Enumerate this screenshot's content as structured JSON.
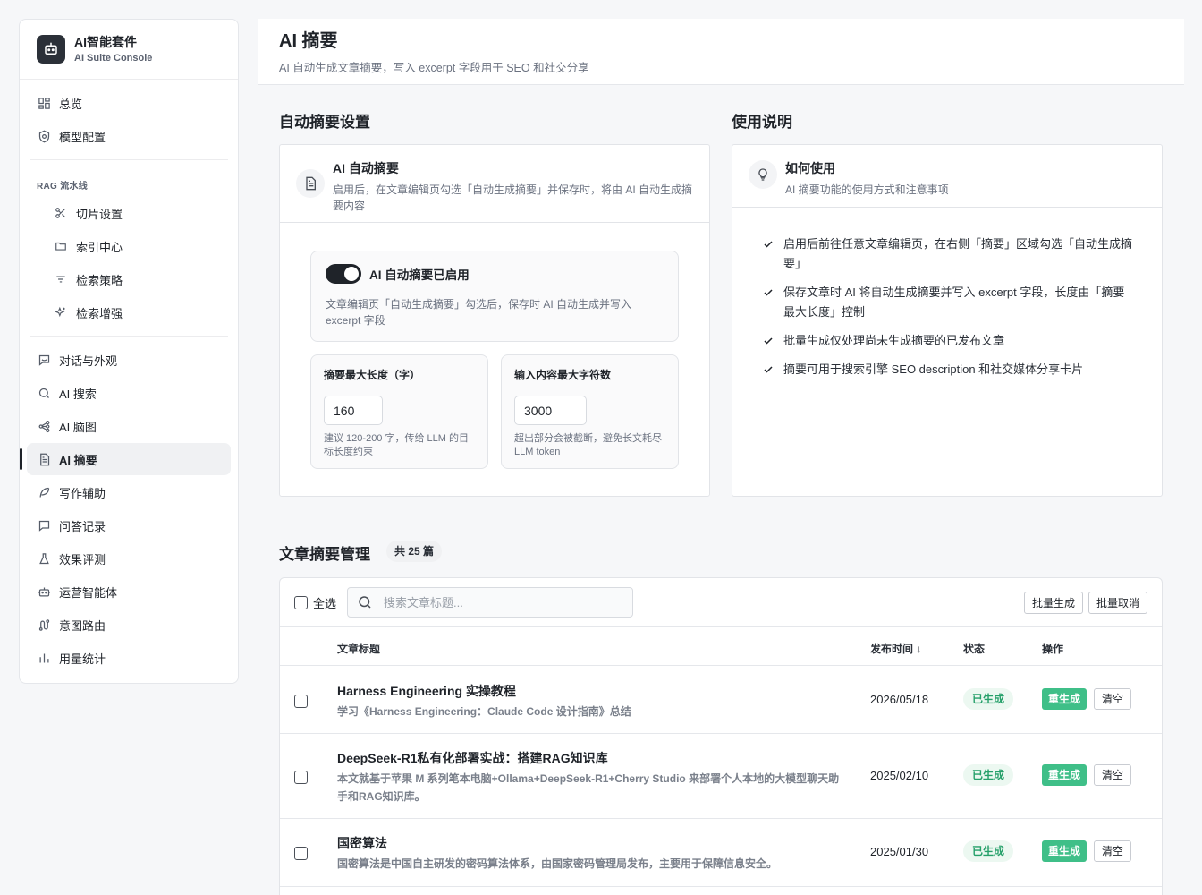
{
  "brand": {
    "title": "AI智能套件",
    "subtitle": "AI Suite Console"
  },
  "sidebar": {
    "top": [
      {
        "label": "总览",
        "icon": "dashboard-icon"
      },
      {
        "label": "模型配置",
        "icon": "model-config-icon"
      }
    ],
    "rag_group": "RAG 流水线",
    "rag": [
      {
        "label": "切片设置",
        "icon": "scissors-icon"
      },
      {
        "label": "索引中心",
        "icon": "folder-icon"
      },
      {
        "label": "检索策略",
        "icon": "filter-icon"
      },
      {
        "label": "检索增强",
        "icon": "sparkle-icon"
      }
    ],
    "main": [
      {
        "label": "对话与外观",
        "icon": "chat-icon"
      },
      {
        "label": "AI 搜索",
        "icon": "search-icon"
      },
      {
        "label": "AI 脑图",
        "icon": "mindmap-icon"
      },
      {
        "label": "AI 摘要",
        "icon": "document-icon",
        "active": true
      },
      {
        "label": "写作辅助",
        "icon": "feather-icon"
      },
      {
        "label": "问答记录",
        "icon": "message-icon"
      },
      {
        "label": "效果评测",
        "icon": "flask-icon"
      },
      {
        "label": "运营智能体",
        "icon": "robot-icon"
      },
      {
        "label": "意图路由",
        "icon": "route-icon"
      },
      {
        "label": "用量统计",
        "icon": "bar-chart-icon"
      }
    ]
  },
  "header": {
    "title": "AI 摘要",
    "subtitle": "AI 自动生成文章摘要，写入 excerpt 字段用于 SEO 和社交分享"
  },
  "settings": {
    "section_title": "自动摘要设置",
    "card_title": "AI 自动摘要",
    "card_desc": "启用后，在文章编辑页勾选「自动生成摘要」并保存时，将由 AI 自动生成摘要内容",
    "toggle_label": "AI 自动摘要已启用",
    "toggle_on": true,
    "toggle_desc": "文章编辑页「自动生成摘要」勾选后，保存时 AI 自动生成并写入 excerpt 字段",
    "max_len_label": "摘要最大长度（字）",
    "max_len_value": "160",
    "max_len_hint": "建议 120-200 字，传给 LLM 的目标长度约束",
    "max_input_label": "输入内容最大字符数",
    "max_input_value": "3000",
    "max_input_hint": "超出部分会被截断，避免长文耗尽 LLM token"
  },
  "usage": {
    "section_title": "使用说明",
    "card_title": "如何使用",
    "card_desc": "AI 摘要功能的使用方式和注意事项",
    "tips": [
      "启用后前往任意文章编辑页，在右侧「摘要」区域勾选「自动生成摘要」",
      "保存文章时 AI 将自动生成摘要并写入 excerpt 字段，长度由「摘要最大长度」控制",
      "批量生成仅处理尚未生成摘要的已发布文章",
      "摘要可用于搜索引擎 SEO description 和社交媒体分享卡片"
    ]
  },
  "articles": {
    "section_title": "文章摘要管理",
    "count_label": "共 25 篇",
    "select_all": "全选",
    "search_placeholder": "搜索文章标题...",
    "batch_generate": "批量生成",
    "batch_cancel": "批量取消",
    "columns": {
      "title": "文章标题",
      "date": "发布时间 ↓",
      "status": "状态",
      "actions": "操作"
    },
    "regen_label": "重生成",
    "clear_label": "清空",
    "rows": [
      {
        "title": "Harness Engineering 实操教程",
        "excerpt": "学习《Harness Engineering：Claude Code 设计指南》总结",
        "date": "2026/05/18",
        "status": "已生成"
      },
      {
        "title": "DeepSeek-R1私有化部署实战：搭建RAG知识库",
        "excerpt": "本文就基于苹果 M 系列笔本电脑+Ollama+DeepSeek-R1+Cherry Studio 来部署个人本地的大模型聊天助手和RAG知识库。",
        "date": "2025/02/10",
        "status": "已生成"
      },
      {
        "title": "国密算法",
        "excerpt": "国密算法是中国自主研发的密码算法体系，由国家密码管理局发布，主要用于保障信息安全。",
        "date": "2025/01/30",
        "status": "已生成"
      }
    ]
  }
}
